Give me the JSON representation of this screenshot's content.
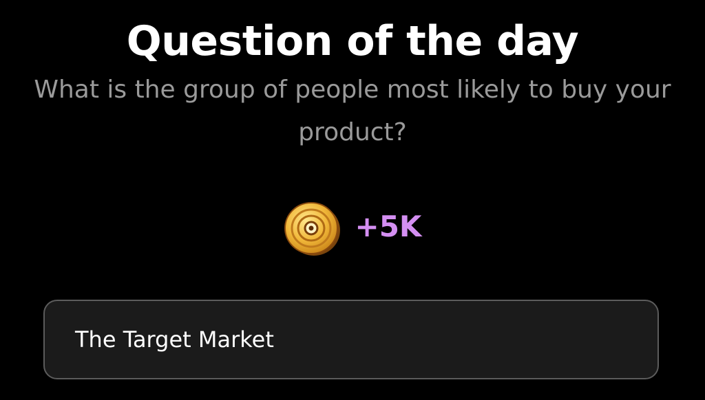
{
  "header": {
    "title": "Question of the day"
  },
  "question": {
    "text": "What is the group of people most likely to buy your product?"
  },
  "reward": {
    "icon": "coin-icon",
    "amount": "+5K",
    "amount_color": "#d48ff2"
  },
  "answers": [
    {
      "label": "The Target Market"
    }
  ],
  "colors": {
    "background": "#000000",
    "title": "#ffffff",
    "question": "#9a9a9a",
    "answer_bg": "#1b1b1b",
    "answer_border": "#5c5c5c"
  }
}
